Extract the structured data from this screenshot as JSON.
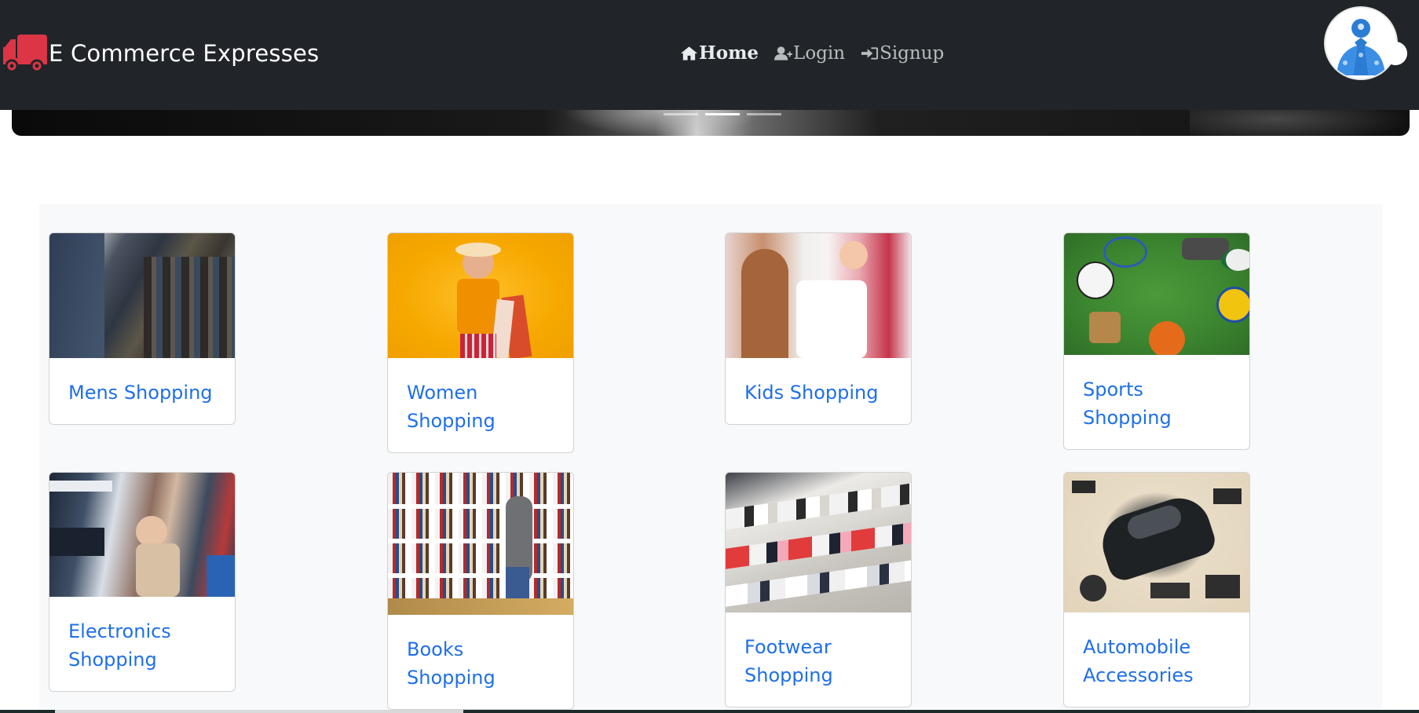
{
  "brand": {
    "name": "E Commerce Expresses",
    "icon": "truck-icon",
    "icon_color": "#dc3545"
  },
  "nav": {
    "items": [
      {
        "label": "Home",
        "icon": "home-icon",
        "active": true
      },
      {
        "label": "Login",
        "icon": "user-plus-icon",
        "active": false
      },
      {
        "label": "Signup",
        "icon": "sign-in-icon",
        "active": false
      }
    ]
  },
  "carousel": {
    "slides": 3,
    "active_index": 1
  },
  "categories": [
    {
      "title": "Mens Shopping",
      "image": "mens-clothing-rack-photo"
    },
    {
      "title": "Women Shopping",
      "image": "woman-with-shopping-bags-photo"
    },
    {
      "title": "Kids Shopping",
      "image": "kids-clothing-store-photo"
    },
    {
      "title": "Sports Shopping",
      "image": "sports-equipment-on-grass-photo"
    },
    {
      "title": "Electronics Shopping",
      "image": "electronics-store-shelves-photo"
    },
    {
      "title": "Books Shopping",
      "image": "bookstore-shelves-photo"
    },
    {
      "title": "Footwear Shopping",
      "image": "shoe-display-shelves-photo"
    },
    {
      "title": "Automobile Accessories",
      "image": "car-and-parts-photo"
    }
  ],
  "colors": {
    "navbar_bg": "#212529",
    "link": "#1f6fe8",
    "section_bg": "#f8f9fa"
  }
}
